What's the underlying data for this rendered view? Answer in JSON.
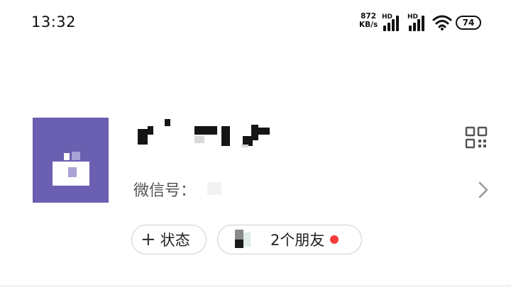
{
  "status_bar": {
    "time": "13:32",
    "net_speed_value": "872",
    "net_speed_unit": "KB/s",
    "sim1_label": "HD",
    "sim2_label": "HD",
    "battery_level": "74"
  },
  "profile": {
    "wechat_id_label": "微信号："
  },
  "chips": {
    "status_plus": "+",
    "status_label": "状态",
    "friends_label": "2个朋友"
  },
  "colors": {
    "avatar_bg": "#6a5fb0",
    "notification_dot": "#f43b3b"
  },
  "icons": [
    "wifi-icon",
    "signal-icon",
    "battery-icon",
    "qr-code-icon",
    "chevron-right-icon",
    "plus-icon"
  ]
}
